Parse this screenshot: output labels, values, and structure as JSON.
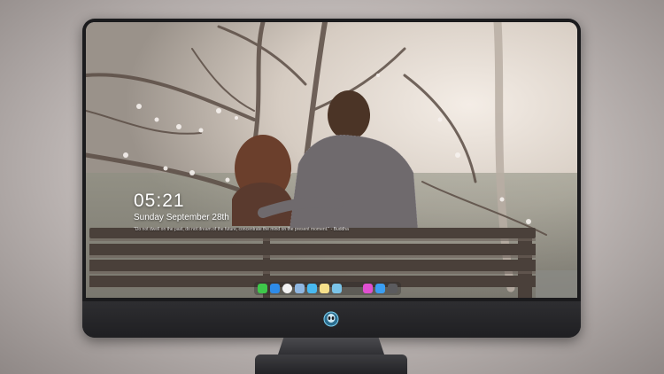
{
  "lock_screen": {
    "time": "05:21",
    "date": "Sunday September 28th",
    "quote": "\"Do not dwell on the past, do not dream of the future, concentrate the mind on the present moment.\" - Buddha"
  },
  "dock": {
    "apps": [
      {
        "name": "messages-icon",
        "color": "#3ec84a"
      },
      {
        "name": "finder-icon",
        "color": "#2e8be8"
      },
      {
        "name": "clock-icon",
        "color": "#f2f2f2"
      },
      {
        "name": "preview-icon",
        "color": "#8fb6e0"
      },
      {
        "name": "claquette-icon",
        "color": "#48b9f0"
      },
      {
        "name": "notes-icon",
        "color": "#f6e08a"
      },
      {
        "name": "photos-icon",
        "color": "#7bc4e8"
      },
      {
        "name": "itunes-icon",
        "color": "#e04fd0"
      },
      {
        "name": "app-store-icon",
        "color": "#3a9ef2"
      },
      {
        "name": "camera-icon",
        "color": "#5b5b5e"
      }
    ]
  }
}
